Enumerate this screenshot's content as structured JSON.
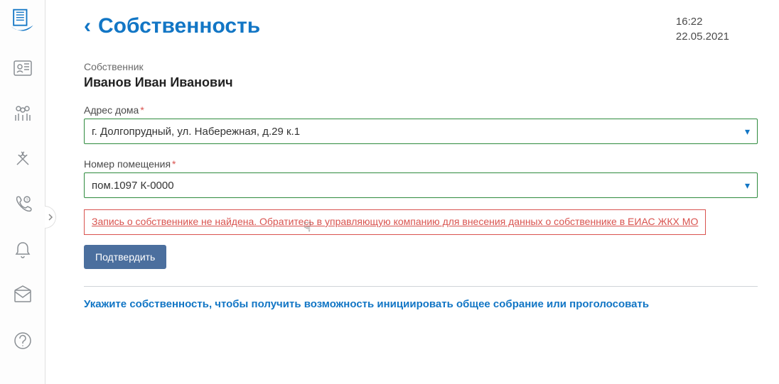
{
  "header": {
    "back_icon": "‹",
    "title": "Собственность",
    "time": "16:22",
    "date": "22.05.2021"
  },
  "owner": {
    "label": "Собственник",
    "name": "Иванов Иван Иванович"
  },
  "address": {
    "label": "Адрес дома",
    "value": "г. Долгопрудный, ул. Набережная, д.29 к.1"
  },
  "room": {
    "label": "Номер помещения",
    "value": "пом.1097 К-0000"
  },
  "error": {
    "text": "Запись о собственнике не найдена. Обратитесь в управляющую компанию для внесения данных о собственнике в ЕИАС ЖКХ МО"
  },
  "confirm_label": "Подтвердить",
  "info": "Укажите собственность, чтобы получить возможность инициировать общее собрание или проголосовать"
}
